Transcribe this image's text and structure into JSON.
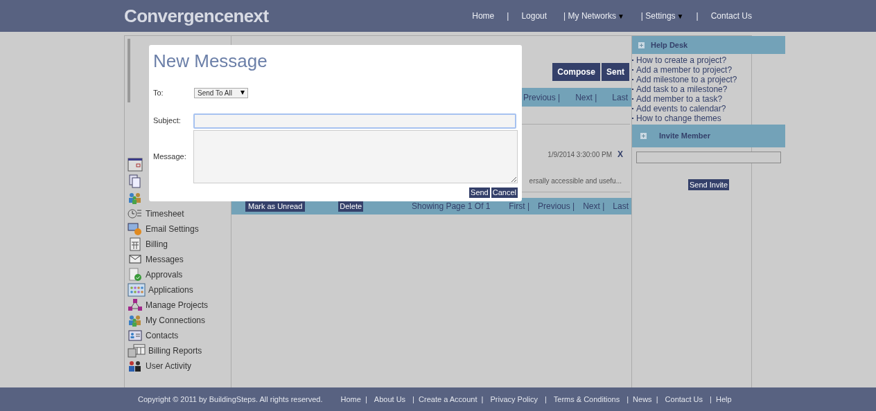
{
  "header": {
    "logo": "Convergencenext",
    "nav": [
      {
        "kind": "link",
        "label": "Home"
      },
      {
        "kind": "separator",
        "label": "|"
      },
      {
        "kind": "link",
        "label": "Logout"
      },
      {
        "kind": "menu",
        "label": "| My Networks",
        "caret": "▼"
      },
      {
        "kind": "menu",
        "label": "| Settings",
        "caret": "▼"
      },
      {
        "kind": "separator",
        "label": "|"
      },
      {
        "kind": "link",
        "label": "Contact Us"
      }
    ]
  },
  "sidebar": {
    "items": [
      {
        "label": "Timesheet"
      },
      {
        "label": "Email Settings"
      },
      {
        "label": "Billing"
      },
      {
        "label": "Messages"
      },
      {
        "label": "Approvals"
      },
      {
        "label": "Applications"
      },
      {
        "label": "Manage Projects"
      },
      {
        "label": "My Connections"
      },
      {
        "label": "Contacts"
      },
      {
        "label": "Billing Reports"
      },
      {
        "label": "User Activity"
      }
    ]
  },
  "inbox": {
    "actions": [
      "Compose",
      "Sent"
    ],
    "top_pager": [
      "Previous |",
      "Next |",
      "Last"
    ],
    "message": {
      "date": "1/9/2014 3:30:00 PM",
      "delete": "X",
      "preview": "ersally accessible and usefu..."
    },
    "bottom_bar": {
      "mark_unread": "Mark as Unread",
      "delete": "Delete",
      "page_info": "Showing Page 1 Of 1",
      "pager": [
        "First |",
        "Previous |",
        "Next |",
        "Last"
      ]
    }
  },
  "help_desk": {
    "title": "Help Desk",
    "links": [
      "How to create a project?",
      "Add a member to project?",
      "Add milestone to a project?",
      "Add task to a milestone?",
      "Add member to a task?",
      "Add events to calendar?",
      "How to change themes"
    ]
  },
  "invite": {
    "title": "Invite Member",
    "button": "Send Invite"
  },
  "dialog": {
    "title": "New Message",
    "to_label": "To:",
    "to_value": "Send To All",
    "subject_label": "Subject:",
    "message_label": "Message:",
    "buttons": [
      "Send",
      "Cancel"
    ]
  },
  "footer": {
    "copyright": "Copyright © 2011 by BuildingSteps. All rights reserved.",
    "links": [
      "Home  |",
      "About Us",
      "|  Create a Account  |",
      "Privacy Policy",
      "|",
      "Terms & Conditions",
      "|  News  |",
      "Contact Us",
      "|  Help"
    ]
  }
}
